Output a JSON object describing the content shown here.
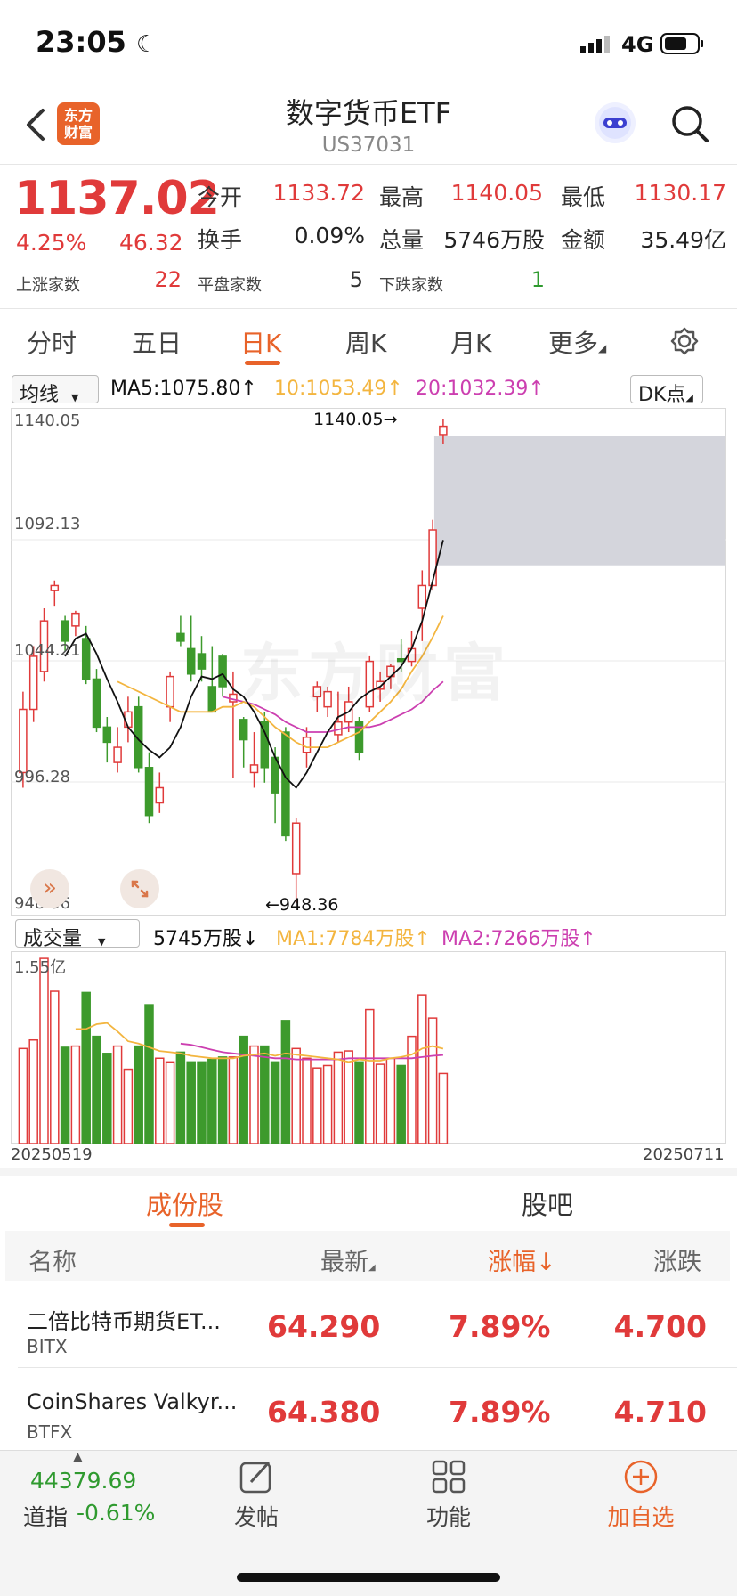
{
  "status": {
    "time": "23:05",
    "network": "4G"
  },
  "header": {
    "title": "数字货币ETF",
    "code": "US37031",
    "brand": "东方财富"
  },
  "quote": {
    "price": "1137.02",
    "change_pct": "4.25%",
    "change": "46.32",
    "open_label": "今开",
    "open": "1133.72",
    "high_label": "最高",
    "high": "1140.05",
    "low_label": "最低",
    "low": "1130.17",
    "turnover_label": "换手",
    "turnover": "0.09%",
    "volume_label": "总量",
    "volume": "5746万股",
    "amount_label": "金额",
    "amount": "35.49亿",
    "up_label": "上涨家数",
    "up": "22",
    "flat_label": "平盘家数",
    "flat": "5",
    "down_label": "下跌家数",
    "down": "1"
  },
  "tabs": [
    "分时",
    "五日",
    "日K",
    "周K",
    "月K",
    "更多"
  ],
  "ma_legend": {
    "selector": "均线",
    "ma5": "MA5:1075.80↑",
    "ma10": "10:1053.49↑",
    "ma20": "20:1032.39↑",
    "dk": "DK点"
  },
  "vol_legend": {
    "selector": "成交量",
    "vol": "5745万股↓",
    "ma1": "MA1:7784万股↑",
    "ma2": "MA2:7266万股↑"
  },
  "colors": {
    "up": "#e03a3a",
    "down": "#3d9a2c",
    "ma5": "#111111",
    "ma10": "#f3b53f",
    "ma20": "#cc3fb0",
    "accent": "#e8632a"
  },
  "chart_data": {
    "type": "candlestick",
    "watermark": "东方财富",
    "price_axis_labels": [
      "1140.05",
      "1092.13",
      "1044.21",
      "996.28",
      "948.36"
    ],
    "ylim": [
      948.36,
      1140.05
    ],
    "annotations": {
      "high": "1140.05→",
      "low": "←948.36"
    },
    "vol_axis_label": "1.55亿",
    "date_start": "20250519",
    "date_end": "20250711",
    "candles": [
      [
        1000,
        1025,
        994,
        1032
      ],
      [
        1025,
        1046,
        1020,
        1050
      ],
      [
        1040,
        1060,
        1036,
        1065
      ],
      [
        1072,
        1074,
        1066,
        1076
      ],
      [
        1060,
        1052,
        1048,
        1062
      ],
      [
        1058,
        1063,
        1054,
        1064
      ],
      [
        1053,
        1037,
        1035,
        1058
      ],
      [
        1037,
        1018,
        1016,
        1041
      ],
      [
        1018,
        1012,
        1004,
        1022
      ],
      [
        1004,
        1010,
        1000,
        1018
      ],
      [
        1018,
        1024,
        1012,
        1030
      ],
      [
        1026,
        1002,
        1000,
        1030
      ],
      [
        1002,
        983,
        980,
        1008
      ],
      [
        988,
        994,
        984,
        1000
      ],
      [
        1026,
        1038,
        1020,
        1040
      ],
      [
        1055,
        1052,
        1050,
        1062
      ],
      [
        1049,
        1039,
        1036,
        1062
      ],
      [
        1047,
        1041,
        1036,
        1054
      ],
      [
        1034,
        1024,
        1026,
        1050
      ],
      [
        1046,
        1034,
        1030,
        1047
      ],
      [
        1028,
        1031,
        998,
        1040
      ],
      [
        1021,
        1013,
        1002,
        1022
      ],
      [
        1000,
        1003,
        994,
        1016
      ],
      [
        1020,
        1002,
        996,
        1024
      ],
      [
        1006,
        992,
        980,
        1010
      ],
      [
        1016,
        975,
        973,
        1018
      ],
      [
        960,
        980,
        948.36,
        982
      ],
      [
        1008,
        1014,
        1002,
        1018
      ],
      [
        1030,
        1034,
        1024,
        1036
      ],
      [
        1026,
        1032,
        1022,
        1034
      ],
      [
        1015,
        1020,
        1012,
        1032
      ],
      [
        1020,
        1028,
        1016,
        1034
      ],
      [
        1020,
        1008,
        1005,
        1022
      ],
      [
        1026,
        1044,
        1024,
        1046
      ],
      [
        1033,
        1036,
        1028,
        1040
      ],
      [
        1038,
        1042,
        1033,
        1043
      ],
      [
        1045,
        1044,
        1040,
        1053
      ],
      [
        1044,
        1049,
        1042,
        1056
      ],
      [
        1065,
        1074,
        1052,
        1080
      ],
      [
        1074,
        1096,
        1072,
        1100
      ],
      [
        1133.72,
        1137.02,
        1130.17,
        1140.05
      ]
    ],
    "ma5": [
      null,
      null,
      null,
      null,
      1046,
      1053,
      1055,
      1047,
      1037,
      1028,
      1018,
      1013,
      1009,
      1006,
      1010,
      1018,
      1030,
      1038,
      1037,
      1039,
      1033,
      1030,
      1024,
      1016,
      1006,
      998,
      994,
      1000,
      1008,
      1016,
      1022,
      1024,
      1029,
      1032,
      1034,
      1038,
      1042,
      1049,
      1060,
      1075.8,
      1092
    ],
    "ma10": [
      null,
      null,
      null,
      null,
      null,
      null,
      null,
      null,
      null,
      1036,
      1034,
      1032,
      1030,
      1028,
      1026,
      1024,
      1024,
      1024,
      1024,
      1026,
      1026,
      1028,
      1026,
      1022,
      1018,
      1015,
      1012,
      1010,
      1010,
      1010,
      1012,
      1014,
      1016,
      1020,
      1024,
      1028,
      1033,
      1040,
      1046,
      1053.49,
      1062
    ],
    "ma20": [
      null,
      null,
      null,
      null,
      null,
      null,
      null,
      null,
      null,
      null,
      null,
      null,
      null,
      null,
      null,
      null,
      null,
      null,
      null,
      1030,
      1029,
      1028,
      1027,
      1025,
      1023,
      1020,
      1018,
      1016,
      1016,
      1016,
      1017,
      1018,
      1018,
      1018,
      1019,
      1021,
      1023,
      1025,
      1028,
      1032.39,
      1036
    ],
    "volume_wan": [
      7800,
      8500,
      15200,
      12500,
      7900,
      8000,
      12400,
      8800,
      7400,
      8000,
      6100,
      8000,
      11400,
      7000,
      6700,
      7500,
      6700,
      6700,
      6900,
      7100,
      7100,
      8800,
      8000,
      8000,
      6700,
      10100,
      7800,
      7000,
      6200,
      6400,
      7500,
      7600,
      6700,
      11000,
      6500,
      7000,
      6400,
      8800,
      12200,
      10300,
      5745
    ],
    "vol_ma1": [
      null,
      null,
      null,
      null,
      null,
      9400,
      9400,
      9800,
      9900,
      9200,
      8400,
      8200,
      7900,
      7600,
      7500,
      7400,
      7200,
      7100,
      7000,
      7000,
      7000,
      7200,
      7300,
      7400,
      7200,
      7400,
      7300,
      7200,
      7100,
      7000,
      6900,
      6700,
      6900,
      6800,
      6800,
      7000,
      7100,
      7300,
      7800,
      8000,
      7784
    ],
    "vol_ma2": [
      null,
      null,
      null,
      null,
      null,
      null,
      null,
      null,
      null,
      null,
      null,
      null,
      null,
      null,
      null,
      8200,
      8100,
      7900,
      7700,
      7500,
      7400,
      7300,
      7200,
      7100,
      7000,
      7000,
      6900,
      6900,
      6900,
      6900,
      6900,
      7000,
      7000,
      7000,
      7000,
      7000,
      7000,
      7000,
      7100,
      7200,
      7266
    ]
  },
  "section_tabs": [
    "成份股",
    "股吧"
  ],
  "table": {
    "headers": [
      "名称",
      "最新",
      "涨幅↓",
      "涨跌"
    ],
    "rows": [
      {
        "name": "二倍比特币期货ET...",
        "code": "BITX",
        "last": "64.290",
        "pct": "7.89%",
        "chg": "4.700"
      },
      {
        "name": "CoinShares Valkyr...",
        "code": "BTFX",
        "last": "64.380",
        "pct": "7.89%",
        "chg": "4.710"
      }
    ]
  },
  "bottom_nav": {
    "index_value": "44379.69",
    "index_name": "道指",
    "index_change": "-0.61%",
    "post": "发帖",
    "functions": "功能",
    "add_watch": "加自选"
  }
}
